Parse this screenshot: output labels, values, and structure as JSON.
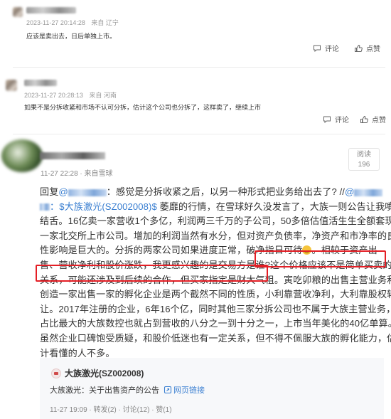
{
  "comments": [
    {
      "timestamp": "2023-11-27 20:14:28",
      "source": "来自 辽宁",
      "text": "应该是卖出去，日后单独上市。",
      "reply_label": "评论",
      "like_label": "点赞"
    },
    {
      "timestamp": "2023-11-27 20:28:13",
      "source": "来自 河南",
      "text": "如果不是分拆收紧和市场不认可分拆，估计这个公司也分拆了，这样卖了，继续上市",
      "reply_label": "评论",
      "like_label": "点赞"
    }
  ],
  "post": {
    "meta": "11-27 22:28 · 来自雪球",
    "read_label": "阅读",
    "read_count": "196",
    "lines": {
      "l1a": "回复",
      "l1b": "@",
      "l1c": "：感觉是分拆收紧之后，以另一种形式把业务给出去了? //",
      "l1d": "@",
      "l2a": "：$大族激光(SZ002008)$",
      "l2b": " 萎靡的行情，在雪球好久没发言了，大族一则公告让我噴目",
      "l3": "结舌。16亿卖一家营收1个多亿，利润两三千万的子公司，50多倍估值活生生全额套现了",
      "l4": "一家北交所上市公司。增加的利润当然有水分，但对资产负债率，净资产和市净率的良",
      "l5a": "性影响是巨大的。分拆的两家公司如果进度正常，破净指日可待",
      "l5b": "。相较于资产出",
      "l6a": "售、营收净利和股价涨跌，我更感兴趣的是交易方是谁?",
      "l6b": "这个价格应该不是简单买卖的",
      "l7a": "关系，可能还涉及到后续的合作，但买家指定是财大气粗。",
      "l7b": "寅吃卯粮的出售主营业务和",
      "l8": "创造一家出售一家的孵化企业是两个截然不同的性质，小利靠营收净利，大利靠股权转",
      "l9": "让。2017年注册的企业，6年16个亿，同时其他三家分拆公司也不属于大族主营业务，",
      "l10": "占比最大的大族数控也就占到营收的八分之一到十分之一，上市当年美化的40亿单算。",
      "l11": "虽然企业口碑饱受质疑，和股价低迷也有一定关系，但不得不佩服大族的孵化能力，估",
      "l12": "计看懂的人不多。"
    },
    "card": {
      "title": "大族激光(SZ002008)",
      "announcement": "大族激光：关于出售资产的公告",
      "link_label": "网页链接",
      "footer": "11-27 19:09 · 转发(2) · 讨论(12) · 赞(1)"
    }
  },
  "colors": {
    "link_blue": "#3a7fd1",
    "highlight_red": "#e41e25"
  }
}
